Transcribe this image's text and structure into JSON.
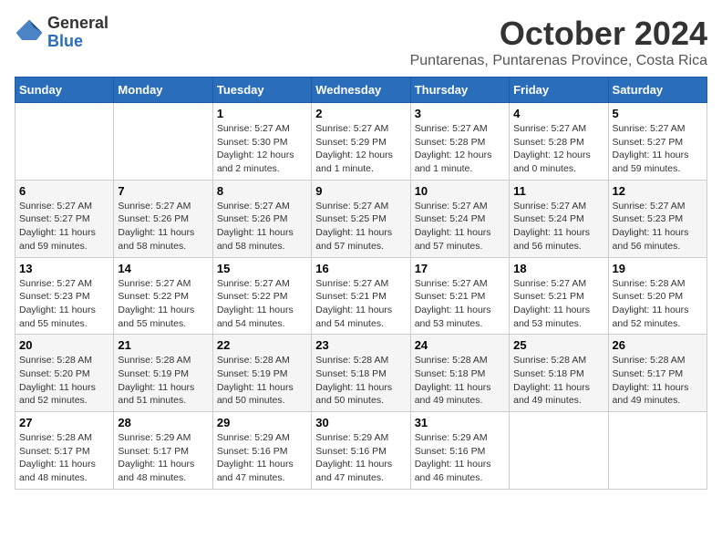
{
  "logo": {
    "general": "General",
    "blue": "Blue"
  },
  "header": {
    "month": "October 2024",
    "location": "Puntarenas, Puntarenas Province, Costa Rica"
  },
  "weekdays": [
    "Sunday",
    "Monday",
    "Tuesday",
    "Wednesday",
    "Thursday",
    "Friday",
    "Saturday"
  ],
  "weeks": [
    [
      {
        "day": "",
        "sunrise": "",
        "sunset": "",
        "daylight": ""
      },
      {
        "day": "",
        "sunrise": "",
        "sunset": "",
        "daylight": ""
      },
      {
        "day": "1",
        "sunrise": "Sunrise: 5:27 AM",
        "sunset": "Sunset: 5:30 PM",
        "daylight": "Daylight: 12 hours and 2 minutes."
      },
      {
        "day": "2",
        "sunrise": "Sunrise: 5:27 AM",
        "sunset": "Sunset: 5:29 PM",
        "daylight": "Daylight: 12 hours and 1 minute."
      },
      {
        "day": "3",
        "sunrise": "Sunrise: 5:27 AM",
        "sunset": "Sunset: 5:28 PM",
        "daylight": "Daylight: 12 hours and 1 minute."
      },
      {
        "day": "4",
        "sunrise": "Sunrise: 5:27 AM",
        "sunset": "Sunset: 5:28 PM",
        "daylight": "Daylight: 12 hours and 0 minutes."
      },
      {
        "day": "5",
        "sunrise": "Sunrise: 5:27 AM",
        "sunset": "Sunset: 5:27 PM",
        "daylight": "Daylight: 11 hours and 59 minutes."
      }
    ],
    [
      {
        "day": "6",
        "sunrise": "Sunrise: 5:27 AM",
        "sunset": "Sunset: 5:27 PM",
        "daylight": "Daylight: 11 hours and 59 minutes."
      },
      {
        "day": "7",
        "sunrise": "Sunrise: 5:27 AM",
        "sunset": "Sunset: 5:26 PM",
        "daylight": "Daylight: 11 hours and 58 minutes."
      },
      {
        "day": "8",
        "sunrise": "Sunrise: 5:27 AM",
        "sunset": "Sunset: 5:26 PM",
        "daylight": "Daylight: 11 hours and 58 minutes."
      },
      {
        "day": "9",
        "sunrise": "Sunrise: 5:27 AM",
        "sunset": "Sunset: 5:25 PM",
        "daylight": "Daylight: 11 hours and 57 minutes."
      },
      {
        "day": "10",
        "sunrise": "Sunrise: 5:27 AM",
        "sunset": "Sunset: 5:24 PM",
        "daylight": "Daylight: 11 hours and 57 minutes."
      },
      {
        "day": "11",
        "sunrise": "Sunrise: 5:27 AM",
        "sunset": "Sunset: 5:24 PM",
        "daylight": "Daylight: 11 hours and 56 minutes."
      },
      {
        "day": "12",
        "sunrise": "Sunrise: 5:27 AM",
        "sunset": "Sunset: 5:23 PM",
        "daylight": "Daylight: 11 hours and 56 minutes."
      }
    ],
    [
      {
        "day": "13",
        "sunrise": "Sunrise: 5:27 AM",
        "sunset": "Sunset: 5:23 PM",
        "daylight": "Daylight: 11 hours and 55 minutes."
      },
      {
        "day": "14",
        "sunrise": "Sunrise: 5:27 AM",
        "sunset": "Sunset: 5:22 PM",
        "daylight": "Daylight: 11 hours and 55 minutes."
      },
      {
        "day": "15",
        "sunrise": "Sunrise: 5:27 AM",
        "sunset": "Sunset: 5:22 PM",
        "daylight": "Daylight: 11 hours and 54 minutes."
      },
      {
        "day": "16",
        "sunrise": "Sunrise: 5:27 AM",
        "sunset": "Sunset: 5:21 PM",
        "daylight": "Daylight: 11 hours and 54 minutes."
      },
      {
        "day": "17",
        "sunrise": "Sunrise: 5:27 AM",
        "sunset": "Sunset: 5:21 PM",
        "daylight": "Daylight: 11 hours and 53 minutes."
      },
      {
        "day": "18",
        "sunrise": "Sunrise: 5:27 AM",
        "sunset": "Sunset: 5:21 PM",
        "daylight": "Daylight: 11 hours and 53 minutes."
      },
      {
        "day": "19",
        "sunrise": "Sunrise: 5:28 AM",
        "sunset": "Sunset: 5:20 PM",
        "daylight": "Daylight: 11 hours and 52 minutes."
      }
    ],
    [
      {
        "day": "20",
        "sunrise": "Sunrise: 5:28 AM",
        "sunset": "Sunset: 5:20 PM",
        "daylight": "Daylight: 11 hours and 52 minutes."
      },
      {
        "day": "21",
        "sunrise": "Sunrise: 5:28 AM",
        "sunset": "Sunset: 5:19 PM",
        "daylight": "Daylight: 11 hours and 51 minutes."
      },
      {
        "day": "22",
        "sunrise": "Sunrise: 5:28 AM",
        "sunset": "Sunset: 5:19 PM",
        "daylight": "Daylight: 11 hours and 50 minutes."
      },
      {
        "day": "23",
        "sunrise": "Sunrise: 5:28 AM",
        "sunset": "Sunset: 5:18 PM",
        "daylight": "Daylight: 11 hours and 50 minutes."
      },
      {
        "day": "24",
        "sunrise": "Sunrise: 5:28 AM",
        "sunset": "Sunset: 5:18 PM",
        "daylight": "Daylight: 11 hours and 49 minutes."
      },
      {
        "day": "25",
        "sunrise": "Sunrise: 5:28 AM",
        "sunset": "Sunset: 5:18 PM",
        "daylight": "Daylight: 11 hours and 49 minutes."
      },
      {
        "day": "26",
        "sunrise": "Sunrise: 5:28 AM",
        "sunset": "Sunset: 5:17 PM",
        "daylight": "Daylight: 11 hours and 49 minutes."
      }
    ],
    [
      {
        "day": "27",
        "sunrise": "Sunrise: 5:28 AM",
        "sunset": "Sunset: 5:17 PM",
        "daylight": "Daylight: 11 hours and 48 minutes."
      },
      {
        "day": "28",
        "sunrise": "Sunrise: 5:29 AM",
        "sunset": "Sunset: 5:17 PM",
        "daylight": "Daylight: 11 hours and 48 minutes."
      },
      {
        "day": "29",
        "sunrise": "Sunrise: 5:29 AM",
        "sunset": "Sunset: 5:16 PM",
        "daylight": "Daylight: 11 hours and 47 minutes."
      },
      {
        "day": "30",
        "sunrise": "Sunrise: 5:29 AM",
        "sunset": "Sunset: 5:16 PM",
        "daylight": "Daylight: 11 hours and 47 minutes."
      },
      {
        "day": "31",
        "sunrise": "Sunrise: 5:29 AM",
        "sunset": "Sunset: 5:16 PM",
        "daylight": "Daylight: 11 hours and 46 minutes."
      },
      {
        "day": "",
        "sunrise": "",
        "sunset": "",
        "daylight": ""
      },
      {
        "day": "",
        "sunrise": "",
        "sunset": "",
        "daylight": ""
      }
    ]
  ]
}
